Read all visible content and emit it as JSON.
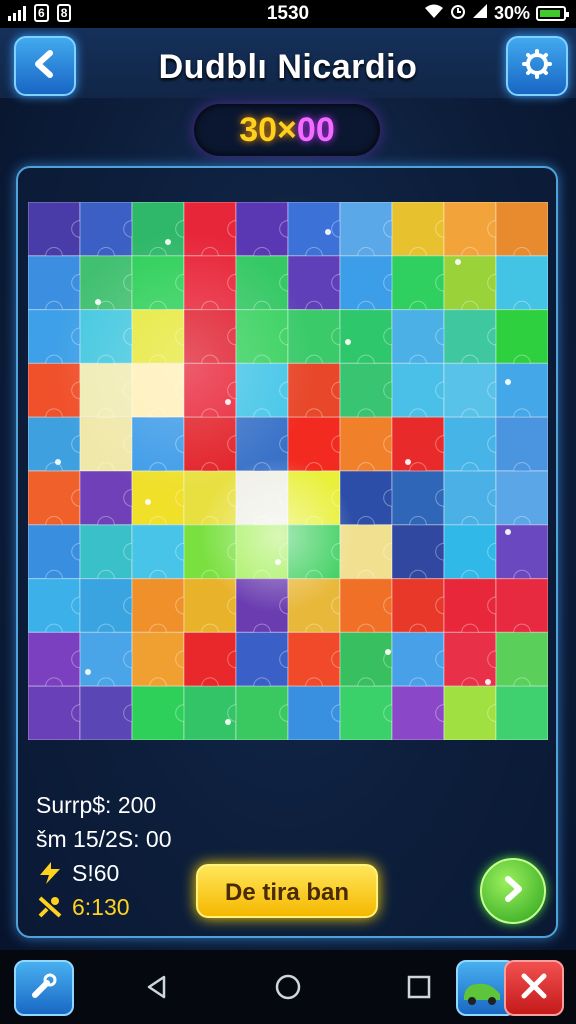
{
  "status_bar": {
    "left_icons": [
      "signal-icon",
      "sim-icon-1",
      "sim-icon-2"
    ],
    "left_text_1": "6",
    "left_text_2": "8",
    "time": "1530",
    "battery": "30%",
    "right_icons": [
      "wifi-icon",
      "alarm-icon",
      "signal-icon",
      "battery-icon"
    ]
  },
  "header": {
    "title": "Dudblı Nicardio",
    "back_icon": "back-arrow-icon",
    "settings_icon": "gear-icon"
  },
  "score": {
    "part_a": "30×",
    "part_b": "00"
  },
  "stats": {
    "line1": "Surrp$: 200",
    "line2": "šm 15/2S: 00",
    "line3": "S!60",
    "line4": "6:130"
  },
  "actions": {
    "main_button": "De tira ban",
    "next_icon": "chevron-right-icon"
  },
  "nav": {
    "icons": [
      "wrench-icon",
      "back-triangle-icon",
      "home-circle-icon",
      "recents-square-icon",
      "car-icon",
      "close-icon"
    ]
  },
  "colors": {
    "accent_blue": "#2f8fe0",
    "gold": "#ffd21e",
    "magenta": "#f46bff",
    "green": "#3bd12e",
    "red": "#f2242a"
  },
  "puzzle": {
    "columns": 10,
    "rows": 10,
    "pieces": [
      "#4a3ca8",
      "#3b5fc4",
      "#2fb86a",
      "#e8263a",
      "#5a38b4",
      "#3c72d8",
      "#5aa8e8",
      "#e8c22e",
      "#f2a43a",
      "#e88a2e",
      "#3c8fe0",
      "#41c070",
      "#2fd05a",
      "#e8263a",
      "#35c865",
      "#6040b8",
      "#3c9ee8",
      "#2fd060",
      "#9ad23a",
      "#44c4e4",
      "#3ea0e8",
      "#45c8e0",
      "#e6e83a",
      "#e02030",
      "#3cd262",
      "#3aca6a",
      "#2fc76c",
      "#4ab0e6",
      "#3fc8a0",
      "#2fd040",
      "#f0502a",
      "#f0ecb4",
      "#fff0b8",
      "#e8263a",
      "#47c6e8",
      "#e8472a",
      "#38c470",
      "#4ac0e8",
      "#58c2e8",
      "#44a8e8",
      "#3fa0e0",
      "#f0e8a8",
      "#3f9ce8",
      "#e22028",
      "#3a72c8",
      "#f22a20",
      "#f0802a",
      "#e82a2a",
      "#47b4e8",
      "#4a94e0",
      "#f0602a",
      "#7040b8",
      "#f0e02a",
      "#e8e040",
      "#f0f0e8",
      "#e8f038",
      "#2c4ea8",
      "#3066b8",
      "#4ab0e6",
      "#5aa6e6",
      "#3a8ee0",
      "#3ac0c8",
      "#48c4e8",
      "#7ae040",
      "#a8f060",
      "#3fd060",
      "#f0e090",
      "#3048a0",
      "#2fb8e8",
      "#6a48c0",
      "#3cb0e8",
      "#3aa4e0",
      "#f0902a",
      "#e8b22a",
      "#6a3cb0",
      "#e8b83a",
      "#f07028",
      "#e8382a",
      "#e8283a",
      "#e82a40",
      "#7a40c0",
      "#4aa4e8",
      "#f0a030",
      "#e8282a",
      "#3a60c8",
      "#f04a2a",
      "#38c060",
      "#48a0e8",
      "#e83048",
      "#5ad05a",
      "#6a40b8",
      "#5a46b4",
      "#2fd05a",
      "#34c468",
      "#3ac860",
      "#3a90e0",
      "#3ad06a",
      "#8a48c8",
      "#a0e040",
      "#3fd070"
    ]
  }
}
